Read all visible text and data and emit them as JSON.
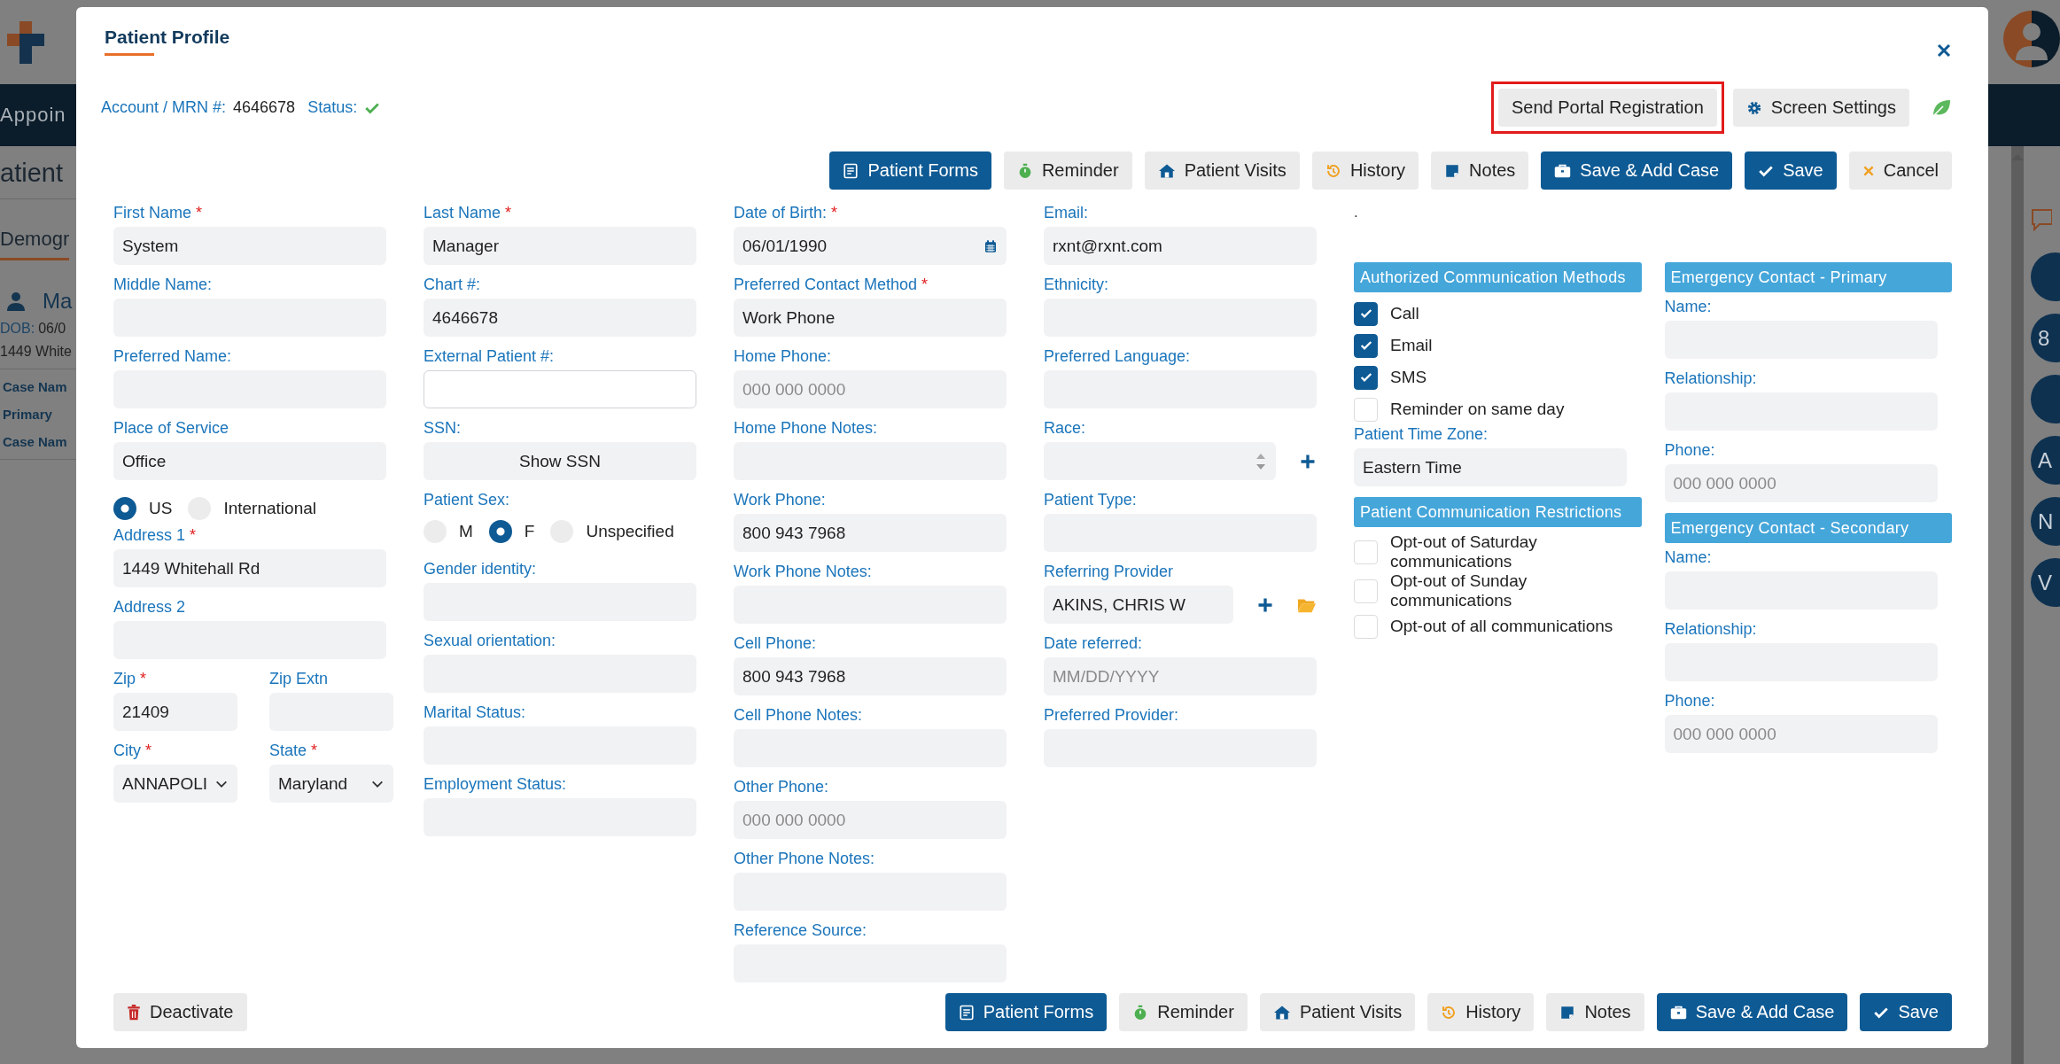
{
  "backdrop": {
    "nav_item": "Appoin",
    "page_heading": "atient",
    "tab": "Demogr",
    "patient_name": "Ma",
    "dob_label": "DOB:",
    "dob_value": "06/0",
    "address": "1449 White",
    "case_rows": [
      "Case Nam",
      "Primary",
      "Case Nam"
    ],
    "side_badges": [
      {
        "kind": "blank"
      },
      {
        "kind": "letter",
        "letter": "8"
      },
      {
        "kind": "blank"
      },
      {
        "kind": "letter",
        "letter": "A"
      },
      {
        "kind": "letter",
        "letter": "N"
      },
      {
        "kind": "letter",
        "letter": "V"
      }
    ]
  },
  "dialog": {
    "title": "Patient Profile",
    "account_label": "Account / MRN #:",
    "account_value": "4646678",
    "status_label": "Status:",
    "header_buttons": [
      {
        "kind": "portal",
        "label": "Send Portal Registration",
        "highlighted": true
      },
      {
        "kind": "settings",
        "label": "Screen Settings",
        "highlighted": false
      }
    ],
    "toolbar": [
      {
        "kind": "forms",
        "label": "Patient Forms"
      },
      {
        "kind": "reminder",
        "label": "Reminder"
      },
      {
        "kind": "visits",
        "label": "Patient Visits"
      },
      {
        "kind": "history",
        "label": "History"
      },
      {
        "kind": "notes",
        "label": "Notes"
      },
      {
        "kind": "save_case",
        "label": "Save & Add Case"
      },
      {
        "kind": "save",
        "label": "Save"
      },
      {
        "kind": "cancel",
        "label": "Cancel"
      }
    ],
    "columns": [
      [
        {
          "kind": "field",
          "label": "First Name",
          "required": "*",
          "value": "System"
        },
        {
          "kind": "field",
          "label": "Middle Name:"
        },
        {
          "kind": "field",
          "label": "Preferred Name:"
        },
        {
          "kind": "field",
          "label": "Place of Service",
          "value": "Office"
        },
        {
          "kind": "radios",
          "options": [
            {
              "label": "US",
              "selected": true
            },
            {
              "label": "International",
              "selected": false
            }
          ]
        },
        {
          "kind": "field",
          "label": "Address 1",
          "required": "*",
          "value": "1449 Whitehall Rd"
        },
        {
          "kind": "field",
          "label": "Address 2"
        },
        {
          "kind": "pair",
          "items": [
            {
              "kind": "field",
              "label": "Zip",
              "required": "*",
              "value": "21409"
            },
            {
              "kind": "field",
              "label": "Zip Extn"
            }
          ]
        },
        {
          "kind": "pair",
          "items": [
            {
              "kind": "select",
              "label": "City",
              "required": "*",
              "value": "ANNAPOLI"
            },
            {
              "kind": "select",
              "label": "State",
              "required": "*",
              "value": "Maryland"
            }
          ]
        }
      ],
      [
        {
          "kind": "field",
          "label": "Last Name",
          "required": "*",
          "value": "Manager"
        },
        {
          "kind": "field",
          "label": "Chart #:",
          "value": "4646678"
        },
        {
          "kind": "outlined",
          "label": "External Patient #:"
        },
        {
          "kind": "reveal",
          "label": "SSN:",
          "button": "Show SSN"
        },
        {
          "kind": "radios",
          "label": "Patient Sex:",
          "options": [
            {
              "label": "M",
              "selected": false
            },
            {
              "label": "F",
              "selected": true
            },
            {
              "label": "Unspecified",
              "selected": false
            }
          ]
        },
        {
          "kind": "field",
          "label": "Gender identity:"
        },
        {
          "kind": "field",
          "label": "Sexual orientation:"
        },
        {
          "kind": "field",
          "label": "Marital Status:"
        },
        {
          "kind": "field",
          "label": "Employment Status:"
        }
      ],
      [
        {
          "kind": "date",
          "label": "Date of Birth:",
          "required": "*",
          "value": "06/01/1990"
        },
        {
          "kind": "field",
          "label": "Preferred Contact Method",
          "required": "*",
          "value": "Work Phone"
        },
        {
          "kind": "field",
          "label": "Home Phone:",
          "placeholder": "000 000 0000"
        },
        {
          "kind": "field",
          "label": "Home Phone Notes:"
        },
        {
          "kind": "field",
          "label": "Work Phone:",
          "value": "800 943 7968"
        },
        {
          "kind": "field",
          "label": "Work Phone Notes:"
        },
        {
          "kind": "field",
          "label": "Cell Phone:",
          "value": "800 943 7968"
        },
        {
          "kind": "field",
          "label": "Cell Phone Notes:"
        },
        {
          "kind": "field",
          "label": "Other Phone:",
          "placeholder": "000 000 0000"
        },
        {
          "kind": "field",
          "label": "Other Phone Notes:"
        },
        {
          "kind": "field",
          "label": "Reference Source:"
        }
      ],
      [
        {
          "kind": "field",
          "label": "Email:",
          "value": "rxnt@rxnt.com"
        },
        {
          "kind": "field",
          "label": "Ethnicity:"
        },
        {
          "kind": "field",
          "label": "Preferred Language:"
        },
        {
          "kind": "spinner",
          "label": "Race:"
        },
        {
          "kind": "field",
          "label": "Patient Type:"
        },
        {
          "kind": "lookup",
          "label": "Referring Provider",
          "value": "AKINS, CHRIS W"
        },
        {
          "kind": "field",
          "label": "Date referred:",
          "placeholder": "MM/DD/YYYY"
        },
        {
          "kind": "field",
          "label": "Preferred Provider:"
        }
      ]
    ],
    "panel_note": ".",
    "panels": [
      [
        {
          "kind": "section",
          "label": "Authorized Communication Methods"
        },
        {
          "kind": "checkbox",
          "label": "Call",
          "checked": true
        },
        {
          "kind": "checkbox",
          "label": "Email",
          "checked": true
        },
        {
          "kind": "checkbox",
          "label": "SMS",
          "checked": true
        },
        {
          "kind": "checkbox",
          "label": "Reminder on same day",
          "checked": false
        },
        {
          "kind": "field",
          "label": "Patient Time Zone:",
          "value": "Eastern Time"
        },
        {
          "kind": "section",
          "label": "Patient Communication Restrictions"
        },
        {
          "kind": "checkbox",
          "label": "Opt-out of Saturday communications",
          "checked": false
        },
        {
          "kind": "checkbox",
          "label": "Opt-out of Sunday communications",
          "checked": false
        },
        {
          "kind": "checkbox",
          "label": "Opt-out of all communications",
          "checked": false
        }
      ],
      [
        {
          "kind": "section",
          "label": "Emergency Contact - Primary"
        },
        {
          "kind": "field",
          "label": "Name:"
        },
        {
          "kind": "field",
          "label": "Relationship:"
        },
        {
          "kind": "field",
          "label": "Phone:",
          "placeholder": "000 000 0000"
        },
        {
          "kind": "section",
          "label": "Emergency Contact - Secondary"
        },
        {
          "kind": "field",
          "label": "Name:"
        },
        {
          "kind": "field",
          "label": "Relationship:"
        },
        {
          "kind": "field",
          "label": "Phone:",
          "placeholder": "000 000 0000"
        }
      ]
    ],
    "footer_left": [
      {
        "kind": "deactivate",
        "label": "Deactivate"
      }
    ],
    "footer": [
      {
        "kind": "forms",
        "label": "Patient Forms"
      },
      {
        "kind": "reminder",
        "label": "Reminder"
      },
      {
        "kind": "visits",
        "label": "Patient Visits"
      },
      {
        "kind": "history",
        "label": "History"
      },
      {
        "kind": "notes",
        "label": "Notes"
      },
      {
        "kind": "save_case",
        "label": "Save & Add Case"
      },
      {
        "kind": "save",
        "label": "Save"
      }
    ]
  }
}
